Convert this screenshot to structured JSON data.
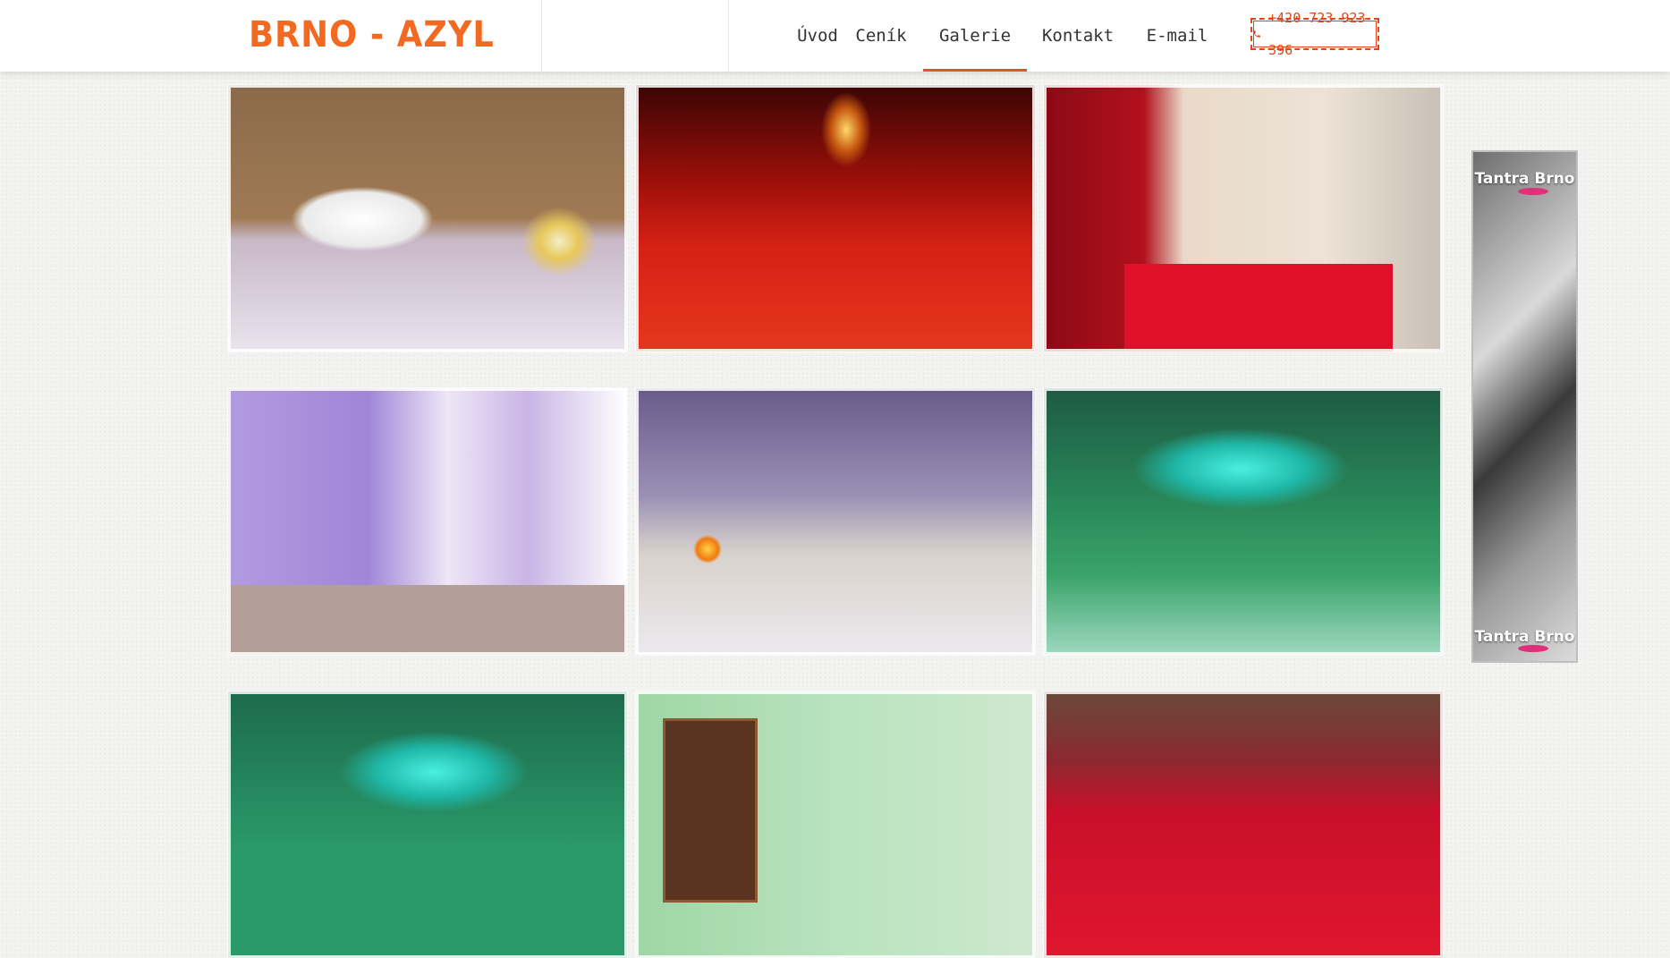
{
  "site": {
    "logo_text": "BRNO - AZYL"
  },
  "nav": {
    "items": [
      {
        "label": "Úvod",
        "active": false
      },
      {
        "label": "Ceník",
        "active": false
      },
      {
        "label": "Galerie",
        "active": true
      },
      {
        "label": "Kontakt",
        "active": false
      },
      {
        "label": "E-mail",
        "active": false
      }
    ],
    "phone": "+420 723 923 396",
    "phone_icon": "phone-icon"
  },
  "colors": {
    "brand_orange": "#f26a21",
    "accent_red": "#e2552a"
  },
  "gallery": {
    "photos": [
      {
        "subject": "towel-and-flower-vase"
      },
      {
        "subject": "red-lit-room"
      },
      {
        "subject": "red-mattress-room"
      },
      {
        "subject": "purple-curtain-room"
      },
      {
        "subject": "white-bed-lamp-room"
      },
      {
        "subject": "teal-green-room"
      },
      {
        "subject": "teal-green-room-2"
      },
      {
        "subject": "green-room-door"
      },
      {
        "subject": "red-bed-champagne"
      }
    ]
  },
  "banner": {
    "top_text": "Tantra Brno",
    "bottom_text": "Tantra Brno"
  }
}
